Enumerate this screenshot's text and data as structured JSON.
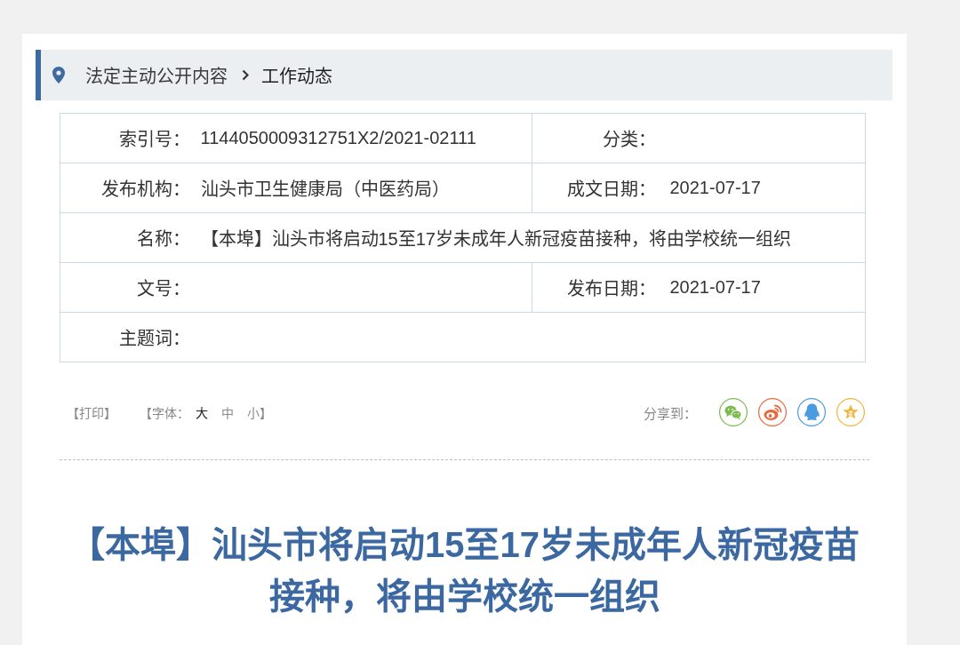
{
  "breadcrumb": {
    "items": [
      {
        "label": "法定主动公开内容"
      },
      {
        "label": "工作动态"
      }
    ]
  },
  "info_table": {
    "rows": [
      {
        "cells": [
          {
            "label": "索引号：",
            "value": "1144050009312751X2/2021-02111"
          },
          {
            "label": "分类："
          }
        ]
      },
      {
        "cells": [
          {
            "label": "发布机构：",
            "value": "汕头市卫生健康局（中医药局）"
          },
          {
            "label": "成文日期：",
            "value": "2021-07-17"
          }
        ]
      },
      {
        "cells": [
          {
            "label": "名称：",
            "value": "【本埠】汕头市将启动15至17岁未成年人新冠疫苗接种，将由学校统一组织"
          }
        ]
      },
      {
        "cells": [
          {
            "label": "文号："
          },
          {
            "label": "发布日期：",
            "value": "2021-07-17"
          }
        ]
      },
      {
        "cells": [
          {
            "label": "主题词："
          }
        ]
      }
    ]
  },
  "tools": {
    "print": "【打印】",
    "font_size": {
      "prefix": "【字体：",
      "options": [
        {
          "label": "大",
          "selected": true
        },
        {
          "label": "中",
          "selected": false
        },
        {
          "label": "小",
          "selected": false
        }
      ],
      "suffix": "】"
    }
  },
  "share": {
    "label": "分享到：",
    "targets": [
      {
        "kind": "chat",
        "color": "#7dbb4f"
      },
      {
        "kind": "eye",
        "color": "#e8673a"
      },
      {
        "kind": "penguin",
        "color": "#4a9be0"
      },
      {
        "kind": "star",
        "color": "#f2b53a"
      }
    ]
  },
  "article": {
    "title": "【本埠】汕头市将启动15至17岁未成年人新冠疫苗接种，将由学校统一组织"
  }
}
